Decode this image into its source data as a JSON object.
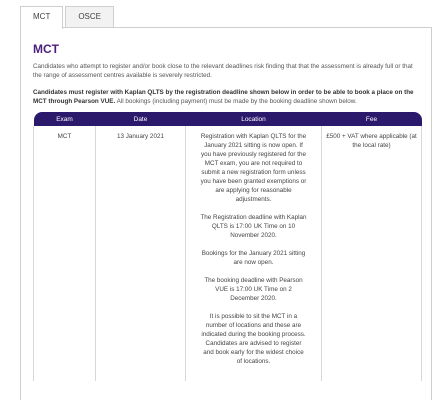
{
  "tabs": [
    {
      "label": "MCT",
      "active": true
    },
    {
      "label": "OSCE",
      "active": false
    }
  ],
  "section_title": "MCT",
  "intro_text": "Candidates who attempt to register and/or book close to the relevant deadlines risk finding that that the assessment is already full or that the range of assessment centres available is severely restricted.",
  "notice_bold": "Candidates must register with Kaplan QLTS by the registration deadline shown below in order to be able to book a place on the MCT through Pearson VUE.",
  "notice_rest": " All bookings (including payment) must be made by the booking deadline shown below.",
  "table": {
    "headers": {
      "exam": "Exam",
      "date": "Date",
      "location": "Location",
      "fee": "Fee"
    },
    "rows": [
      {
        "exam": "MCT",
        "date": "13 January 2021",
        "location": [
          "Registration with Kaplan QLTS for the January 2021 sitting is now open. If you have previously registered for the MCT exam, you are not required to submit a new registration form unless you have been granted exemptions or are applying for reasonable adjustments.",
          "The Registration deadline with Kaplan QLTS is 17:00 UK Time on 10 November 2020.",
          "Bookings for the January 2021 sitting are now open.",
          "The booking deadline with Pearson VUE is 17:00 UK Time on 2 December 2020.",
          "It is possible to sit the MCT in a number of locations and these are indicated during the booking process. Candidates are advised to register and book early for the widest choice of locations."
        ],
        "fee": "£500 + VAT where applicable (at the local rate)"
      }
    ]
  }
}
